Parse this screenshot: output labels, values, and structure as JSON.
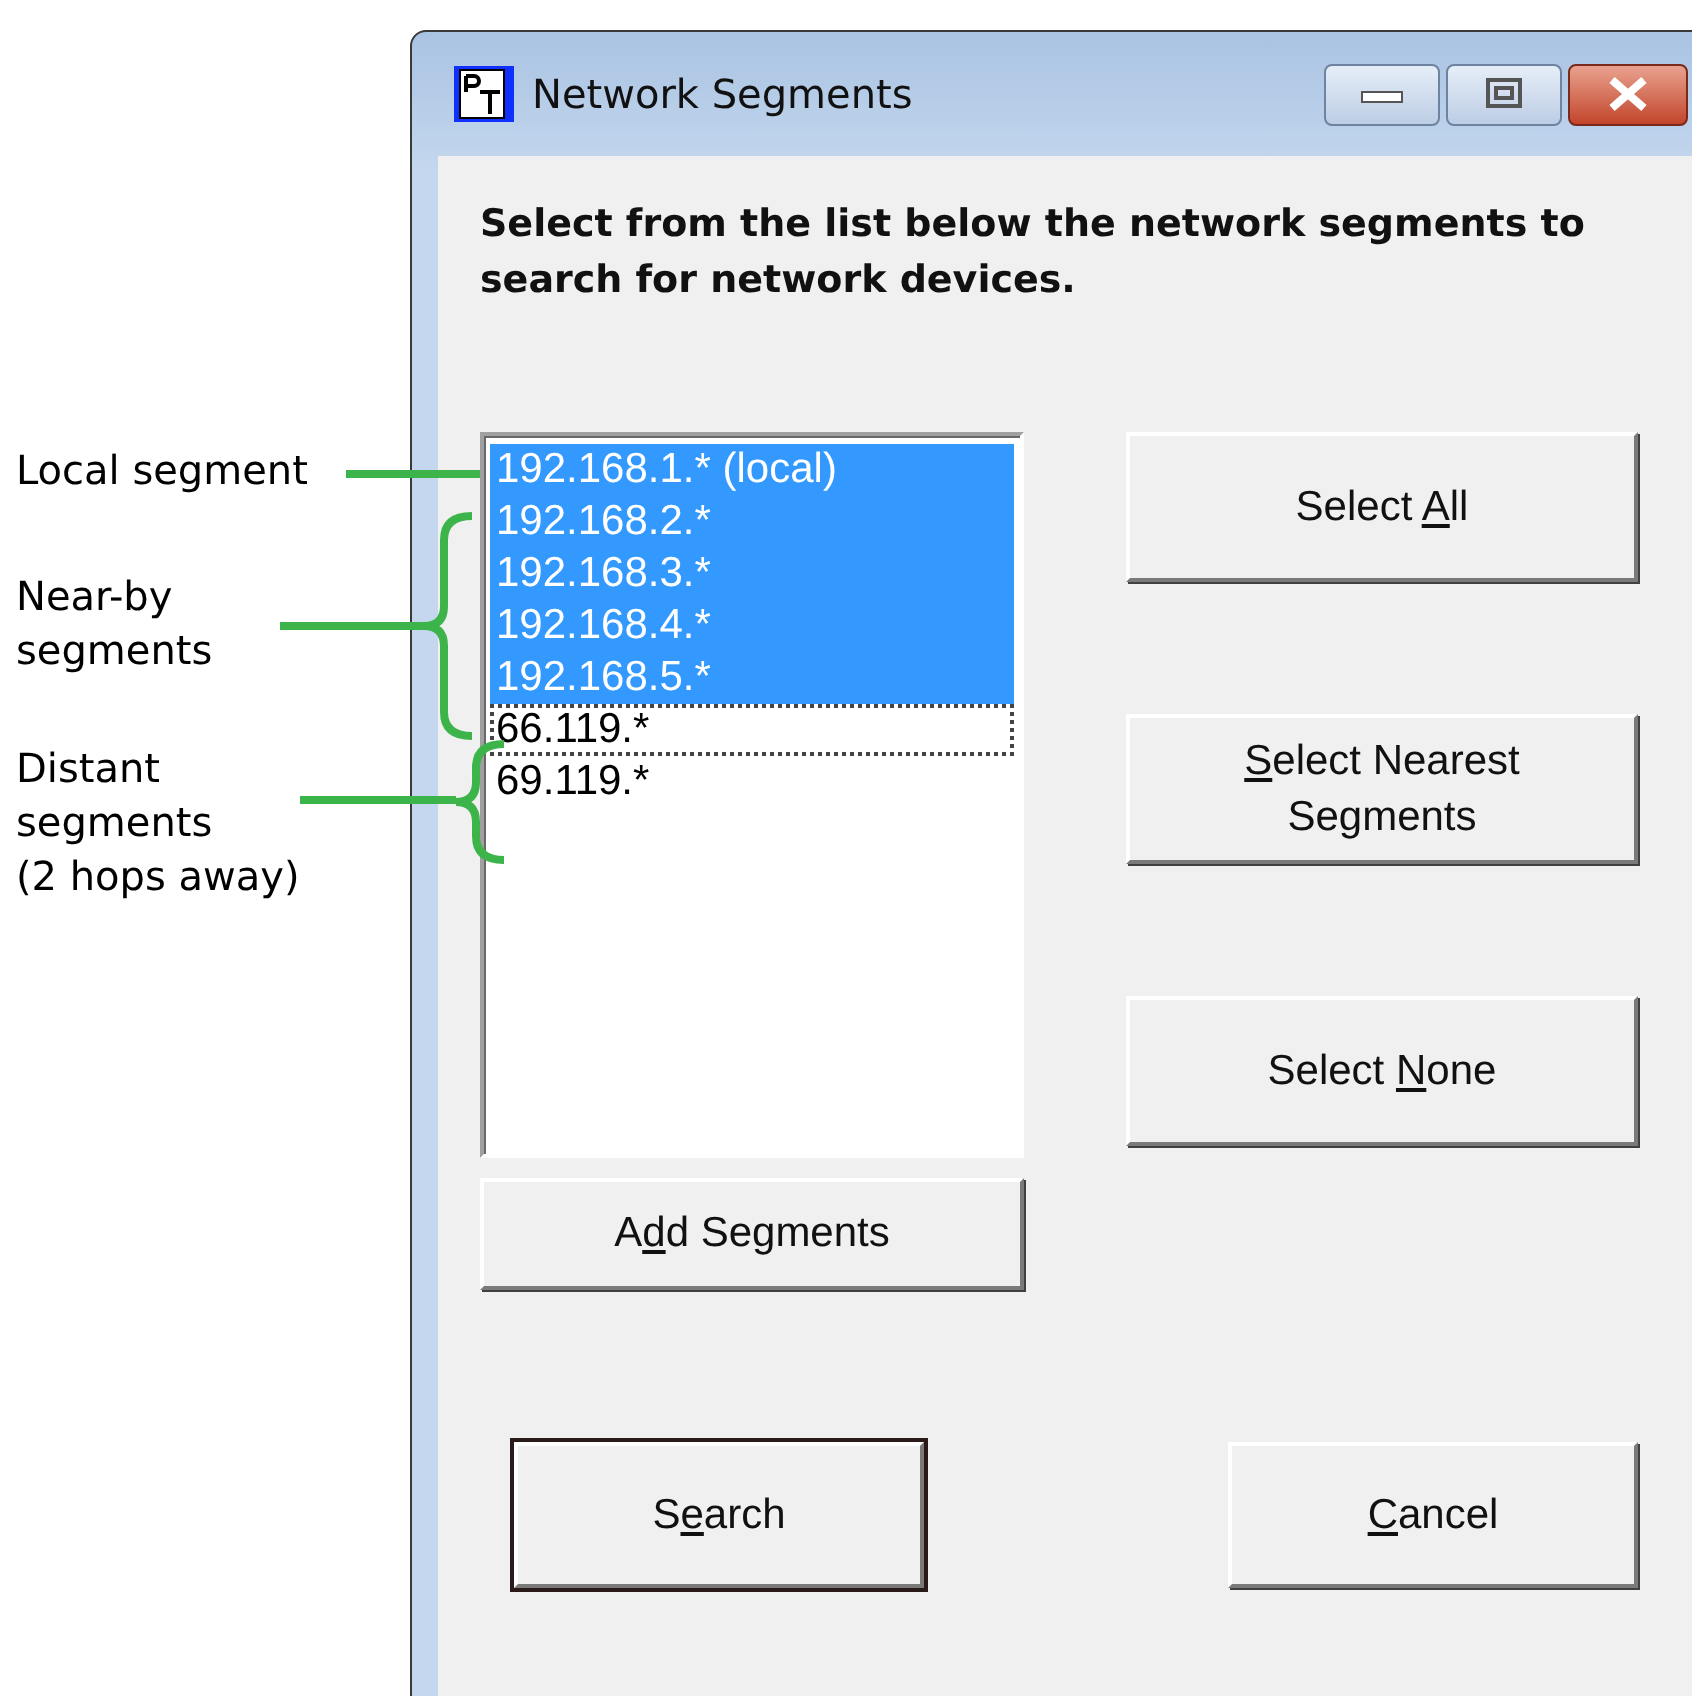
{
  "window": {
    "title": "Network Segments"
  },
  "instruction": "Select from the list below the network segments to search for network devices.",
  "segments": [
    {
      "label": "192.168.1.* (local)",
      "selected": true,
      "focused": false
    },
    {
      "label": "192.168.2.*",
      "selected": true,
      "focused": false
    },
    {
      "label": "192.168.3.*",
      "selected": true,
      "focused": false
    },
    {
      "label": "192.168.4.*",
      "selected": true,
      "focused": false
    },
    {
      "label": "192.168.5.*",
      "selected": true,
      "focused": false
    },
    {
      "label": "66.119.*",
      "selected": false,
      "focused": true
    },
    {
      "label": "69.119.*",
      "selected": false,
      "focused": false
    }
  ],
  "side_buttons": [
    {
      "before": "Select ",
      "key": "A",
      "after": "ll"
    },
    {
      "key": "S",
      "after": "elect Nearest Segments"
    },
    {
      "before": "Select ",
      "key": "N",
      "after": "one"
    }
  ],
  "add_button": {
    "before": "A",
    "key": "d",
    "after": "d Segments"
  },
  "dialog_buttons": [
    {
      "before": "S",
      "key": "e",
      "after": "arch",
      "default": true
    },
    {
      "key": "C",
      "after": "ancel",
      "default": false
    }
  ],
  "annotations": [
    {
      "kind": "line",
      "lines": [
        "Local segment"
      ]
    },
    {
      "kind": "brace",
      "lines": [
        "Near-by",
        "segments"
      ]
    },
    {
      "kind": "brace",
      "lines": [
        "Distant",
        "segments",
        "(2 hops away)"
      ]
    }
  ]
}
